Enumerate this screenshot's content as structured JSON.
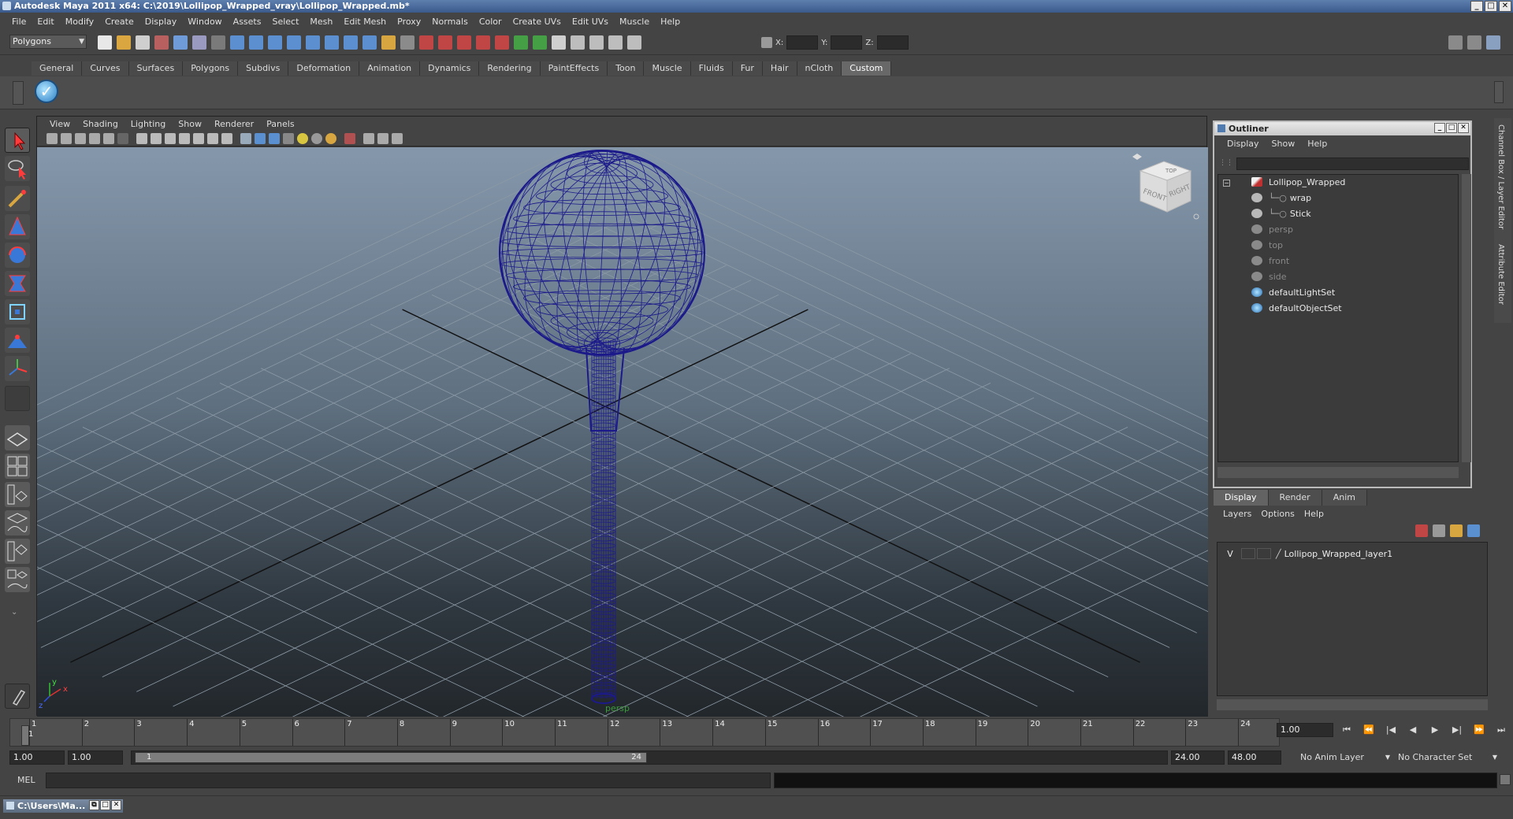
{
  "window": {
    "title": "Autodesk Maya 2011 x64: C:\\2019\\Lollipop_Wrapped_vray\\Lollipop_Wrapped.mb*"
  },
  "menubar": [
    "File",
    "Edit",
    "Modify",
    "Create",
    "Display",
    "Window",
    "Assets",
    "Select",
    "Mesh",
    "Edit Mesh",
    "Proxy",
    "Normals",
    "Color",
    "Create UVs",
    "Edit UVs",
    "Muscle",
    "Help"
  ],
  "statusline": {
    "mode": "Polygons",
    "x_label": "X:",
    "y_label": "Y:",
    "z_label": "Z:"
  },
  "shelf": {
    "tabs": [
      "General",
      "Curves",
      "Surfaces",
      "Polygons",
      "Subdivs",
      "Deformation",
      "Animation",
      "Dynamics",
      "Rendering",
      "PaintEffects",
      "Toon",
      "Muscle",
      "Fluids",
      "Fur",
      "Hair",
      "nCloth",
      "Custom"
    ],
    "active_tab": "Custom"
  },
  "viewport": {
    "menu": [
      "View",
      "Shading",
      "Lighting",
      "Show",
      "Renderer",
      "Panels"
    ],
    "camera_label": "persp",
    "viewcube_front": "FRONT",
    "viewcube_right": "RIGHT",
    "viewcube_top": "TOP",
    "axis_y": "y",
    "axis_x": "x",
    "axis_z": "z",
    "wire_color": "#1c1a8a"
  },
  "outliner": {
    "title": "Outliner",
    "menu": [
      "Display",
      "Show",
      "Help"
    ],
    "items": [
      {
        "label": "Lollipop_Wrapped",
        "dim": false
      },
      {
        "label": "wrap",
        "dim": false
      },
      {
        "label": "Stick",
        "dim": false
      },
      {
        "label": "persp",
        "dim": true
      },
      {
        "label": "top",
        "dim": true
      },
      {
        "label": "front",
        "dim": true
      },
      {
        "label": "side",
        "dim": true
      },
      {
        "label": "defaultLightSet",
        "dim": false
      },
      {
        "label": "defaultObjectSet",
        "dim": false
      }
    ]
  },
  "layer_editor": {
    "tabs": [
      "Display",
      "Render",
      "Anim"
    ],
    "active_tab": "Display",
    "menu": [
      "Layers",
      "Options",
      "Help"
    ],
    "layer_visible": "V",
    "layer_name": "Lollipop_Wrapped_layer1"
  },
  "side_tabs": [
    "Channel Box / Layer Editor",
    "Attribute Editor"
  ],
  "timeline": {
    "ticks": [
      "1",
      "2",
      "3",
      "4",
      "5",
      "6",
      "7",
      "8",
      "9",
      "10",
      "11",
      "12",
      "13",
      "14",
      "15",
      "16",
      "17",
      "18",
      "19",
      "20",
      "21",
      "22",
      "23",
      "24"
    ],
    "current_marker": "1",
    "current_frame": "1.00"
  },
  "range": {
    "start_time": "1.00",
    "playback_start": "1.00",
    "handle_start": "1",
    "handle_end": "24",
    "playback_end": "24.00",
    "end_time": "48.00",
    "anim_layer": "No Anim Layer",
    "character_set": "No Character Set"
  },
  "cmdline": {
    "label": "MEL"
  },
  "taskbar": {
    "item": "C:\\Users\\Ma..."
  }
}
